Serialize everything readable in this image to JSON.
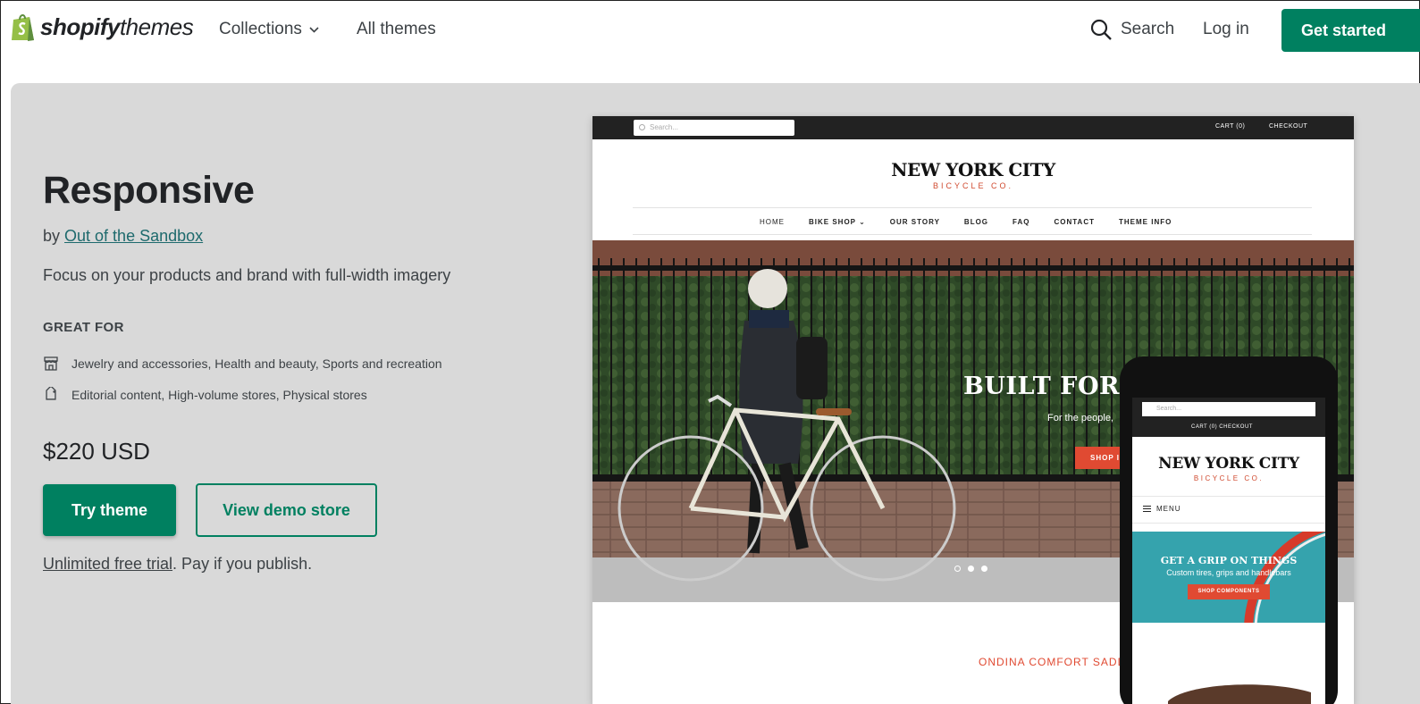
{
  "header": {
    "logo_bold": "shopify",
    "logo_light": "themes",
    "nav": {
      "collections": "Collections",
      "all_themes": "All themes"
    },
    "search_label": "Search",
    "login_label": "Log in",
    "get_started_label": "Get started"
  },
  "theme": {
    "name": "Responsive",
    "by_prefix": "by",
    "author": "Out of the Sandbox",
    "tagline": "Focus on your products and brand with full-width imagery",
    "great_for_heading": "GREAT FOR",
    "great_for_industries": "Jewelry and accessories, Health and beauty, Sports and recreation",
    "great_for_features": "Editorial content, High-volume stores, Physical stores",
    "price": "$220 USD",
    "try_label": "Try theme",
    "demo_label": "View demo store",
    "trial_link": "Unlimited free trial",
    "trial_rest": ". Pay if you publish."
  },
  "preview_desktop": {
    "search_placeholder": "Search...",
    "cart": "CART (0)",
    "checkout": "CHECKOUT",
    "brand_line1": "NEW YORK CITY",
    "brand_line2": "BICYCLE CO.",
    "menu": [
      "HOME",
      "BIKE SHOP ⌄",
      "OUR STORY",
      "BLOG",
      "FAQ",
      "CONTACT",
      "THEME INFO"
    ],
    "hero_title": "BUILT FOR A",
    "hero_sub": "For the people,",
    "hero_button": "SHOP I",
    "product_title": "ONDINA COMFORT SADD"
  },
  "preview_mobile": {
    "search_placeholder": "Search...",
    "cart_checkout": "CART (0)   CHECKOUT",
    "brand_line1": "NEW YORK CITY",
    "brand_line2": "BICYCLE CO.",
    "menu_label": "MENU",
    "banner_title": "GET A GRIP ON THINGS",
    "banner_sub": "Custom tires, grips and handlebars",
    "banner_button": "SHOP COMPONENTS"
  },
  "colors": {
    "brand_green": "#008060",
    "panel_bg": "#d9d9d9",
    "accent_red": "#e04a32"
  }
}
